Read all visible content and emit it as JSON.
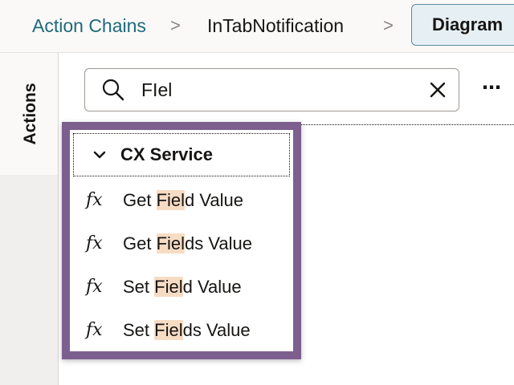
{
  "breadcrumb": {
    "items": [
      {
        "label": "Action Chains"
      },
      {
        "label": "InTabNotification"
      }
    ],
    "separator": ">",
    "active_button": "Diagram"
  },
  "sidebar": {
    "tab_label": "Actions"
  },
  "search": {
    "value": "FIel",
    "clear_icon": "close-icon",
    "search_icon": "search-icon"
  },
  "more_menu": {
    "label": "⋯"
  },
  "dropdown": {
    "group": {
      "label": "CX Service",
      "expanded": true
    },
    "items": [
      {
        "icon": "fx",
        "prefix": "Get ",
        "match": "Fiel",
        "suffix": "d Value"
      },
      {
        "icon": "fx",
        "prefix": "Get ",
        "match": "Fiel",
        "suffix": "ds Value"
      },
      {
        "icon": "fx",
        "prefix": "Set ",
        "match": "Fiel",
        "suffix": "d Value"
      },
      {
        "icon": "fx",
        "prefix": "Set ",
        "match": "Fiel",
        "suffix": "ds Value"
      }
    ]
  },
  "colors": {
    "link": "#1d6a7a",
    "panel_border": "#7c5f8f",
    "highlight": "#f7dcc4",
    "active_button_bg": "#e6f0f4"
  }
}
